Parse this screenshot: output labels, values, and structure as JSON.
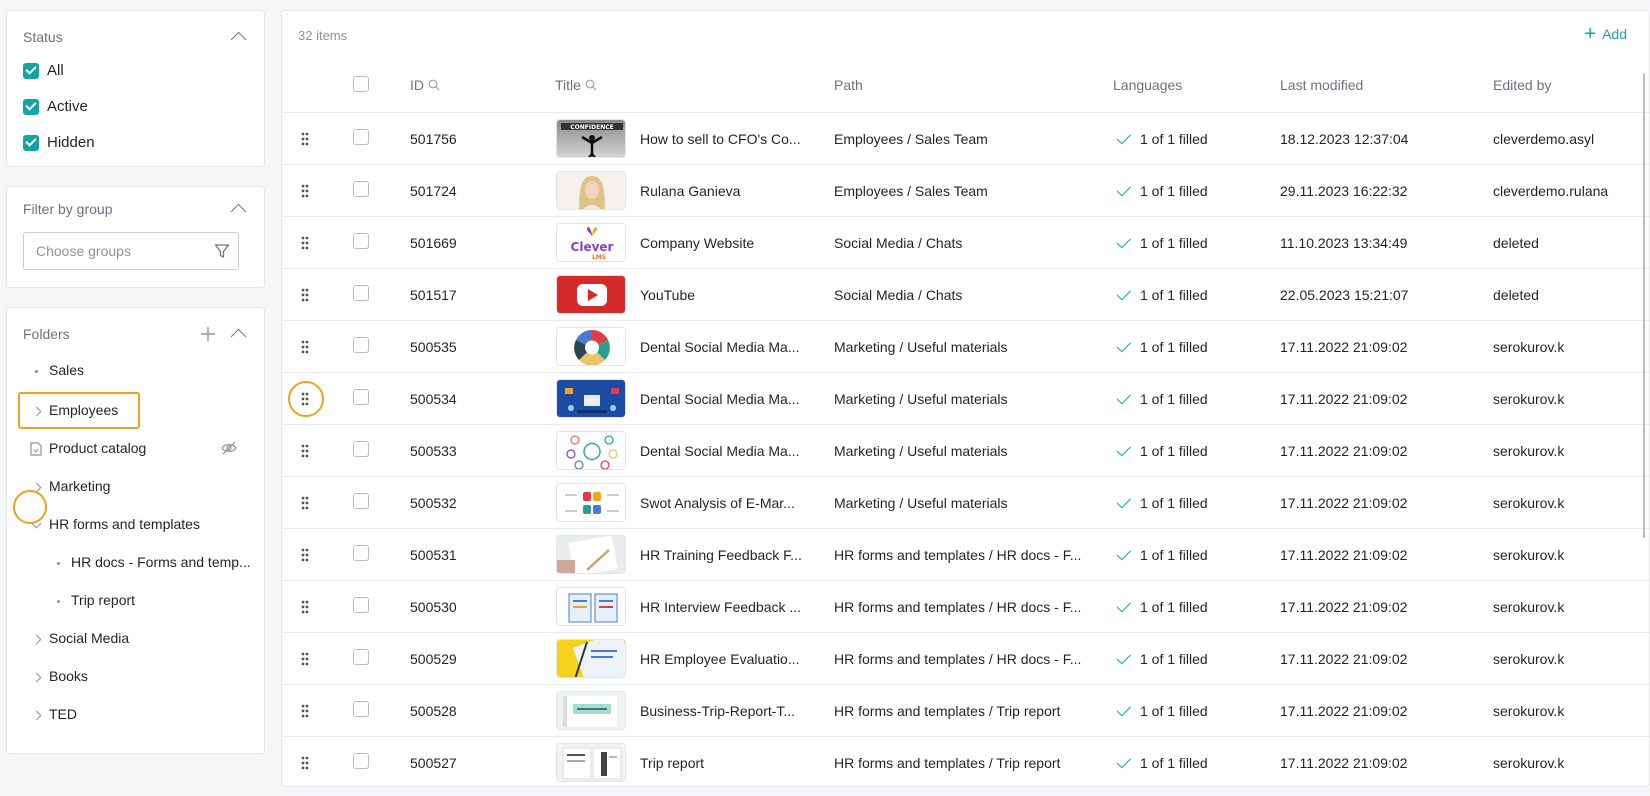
{
  "status_panel": {
    "title": "Status",
    "options": [
      {
        "label": "All",
        "checked": true
      },
      {
        "label": "Active",
        "checked": true
      },
      {
        "label": "Hidden",
        "checked": true
      }
    ]
  },
  "group_panel": {
    "title": "Filter by group",
    "placeholder": "Choose groups"
  },
  "folders_panel": {
    "title": "Folders",
    "items": [
      {
        "label": "Sales",
        "icon": "dot-icon"
      },
      {
        "label": "Employees",
        "icon": "chevron-right-icon",
        "highlighted": true
      },
      {
        "label": "Product catalog",
        "icon": "document-icon",
        "hidden": true
      },
      {
        "label": "Marketing",
        "icon": "chevron-right-icon"
      },
      {
        "label": "HR forms and templates",
        "icon": "chevron-down-icon",
        "expanded": true
      },
      {
        "label": "HR docs - Forms and temp...",
        "icon": "dot-icon",
        "child": true
      },
      {
        "label": "Trip report",
        "icon": "dot-icon",
        "child": true
      },
      {
        "label": "Social Media",
        "icon": "chevron-right-icon"
      },
      {
        "label": "Books",
        "icon": "chevron-right-icon"
      },
      {
        "label": "TED",
        "icon": "chevron-right-icon"
      }
    ]
  },
  "table": {
    "count_text": "32 items",
    "add_label": "Add",
    "columns": [
      "ID",
      "Title",
      "Path",
      "Languages",
      "Last modified",
      "Edited by"
    ],
    "accent": "#17a2a3",
    "highlight": "#f0a01c",
    "rows": [
      {
        "id": "501756",
        "title": "How to sell to CFO's Co...",
        "path": "Employees / Sales Team",
        "lang": "1 of 1 filled",
        "modified": "18.12.2023 12:37:04",
        "editor": "cleverdemo.asyl",
        "thumb": "confidence"
      },
      {
        "id": "501724",
        "title": "Rulana Ganieva",
        "path": "Employees / Sales Team",
        "lang": "1 of 1 filled",
        "modified": "29.11.2023 16:22:32",
        "editor": "cleverdemo.rulana",
        "thumb": "portrait"
      },
      {
        "id": "501669",
        "title": "Company Website",
        "path": "Social Media / Chats",
        "lang": "1 of 1 filled",
        "modified": "11.10.2023 13:34:49",
        "editor": "deleted",
        "thumb": "clever"
      },
      {
        "id": "501517",
        "title": "YouTube",
        "path": "Social Media / Chats",
        "lang": "1 of 1 filled",
        "modified": "22.05.2023 15:21:07",
        "editor": "deleted",
        "thumb": "youtube"
      },
      {
        "id": "500535",
        "title": "Dental Social Media Ma...",
        "path": "Marketing / Useful materials",
        "lang": "1 of 1 filled",
        "modified": "17.11.2022 21:09:02",
        "editor": "serokurov.k",
        "thumb": "wheel"
      },
      {
        "id": "500534",
        "title": "Dental Social Media Ma...",
        "path": "Marketing / Useful materials",
        "lang": "1 of 1 filled",
        "modified": "17.11.2022 21:09:02",
        "editor": "serokurov.k",
        "thumb": "bluescene",
        "drag_highlight": true
      },
      {
        "id": "500533",
        "title": "Dental Social Media Ma...",
        "path": "Marketing / Useful materials",
        "lang": "1 of 1 filled",
        "modified": "17.11.2022 21:09:02",
        "editor": "serokurov.k",
        "thumb": "circles"
      },
      {
        "id": "500532",
        "title": "Swot Analysis of E-Mar...",
        "path": "Marketing / Useful materials",
        "lang": "1 of 1 filled",
        "modified": "17.11.2022 21:09:02",
        "editor": "serokurov.k",
        "thumb": "swot"
      },
      {
        "id": "500531",
        "title": "HR Training Feedback F...",
        "path": "HR forms and templates / HR docs - F...",
        "lang": "1 of 1 filled",
        "modified": "17.11.2022 21:09:02",
        "editor": "serokurov.k",
        "thumb": "paper"
      },
      {
        "id": "500530",
        "title": "HR Interview Feedback ...",
        "path": "HR forms and templates / HR docs - F...",
        "lang": "1 of 1 filled",
        "modified": "17.11.2022 21:09:02",
        "editor": "serokurov.k",
        "thumb": "interview"
      },
      {
        "id": "500529",
        "title": "HR Employee Evaluatio...",
        "path": "HR forms and templates / HR docs - F...",
        "lang": "1 of 1 filled",
        "modified": "17.11.2022 21:09:02",
        "editor": "serokurov.k",
        "thumb": "yellow"
      },
      {
        "id": "500528",
        "title": "Business-Trip-Report-T...",
        "path": "HR forms and templates / Trip report",
        "lang": "1 of 1 filled",
        "modified": "17.11.2022 21:09:02",
        "editor": "serokurov.k",
        "thumb": "trip"
      },
      {
        "id": "500527",
        "title": "Trip report",
        "path": "HR forms and templates / Trip report",
        "lang": "1 of 1 filled",
        "modified": "17.11.2022 21:09:02",
        "editor": "serokurov.k",
        "thumb": "trip2"
      }
    ]
  }
}
